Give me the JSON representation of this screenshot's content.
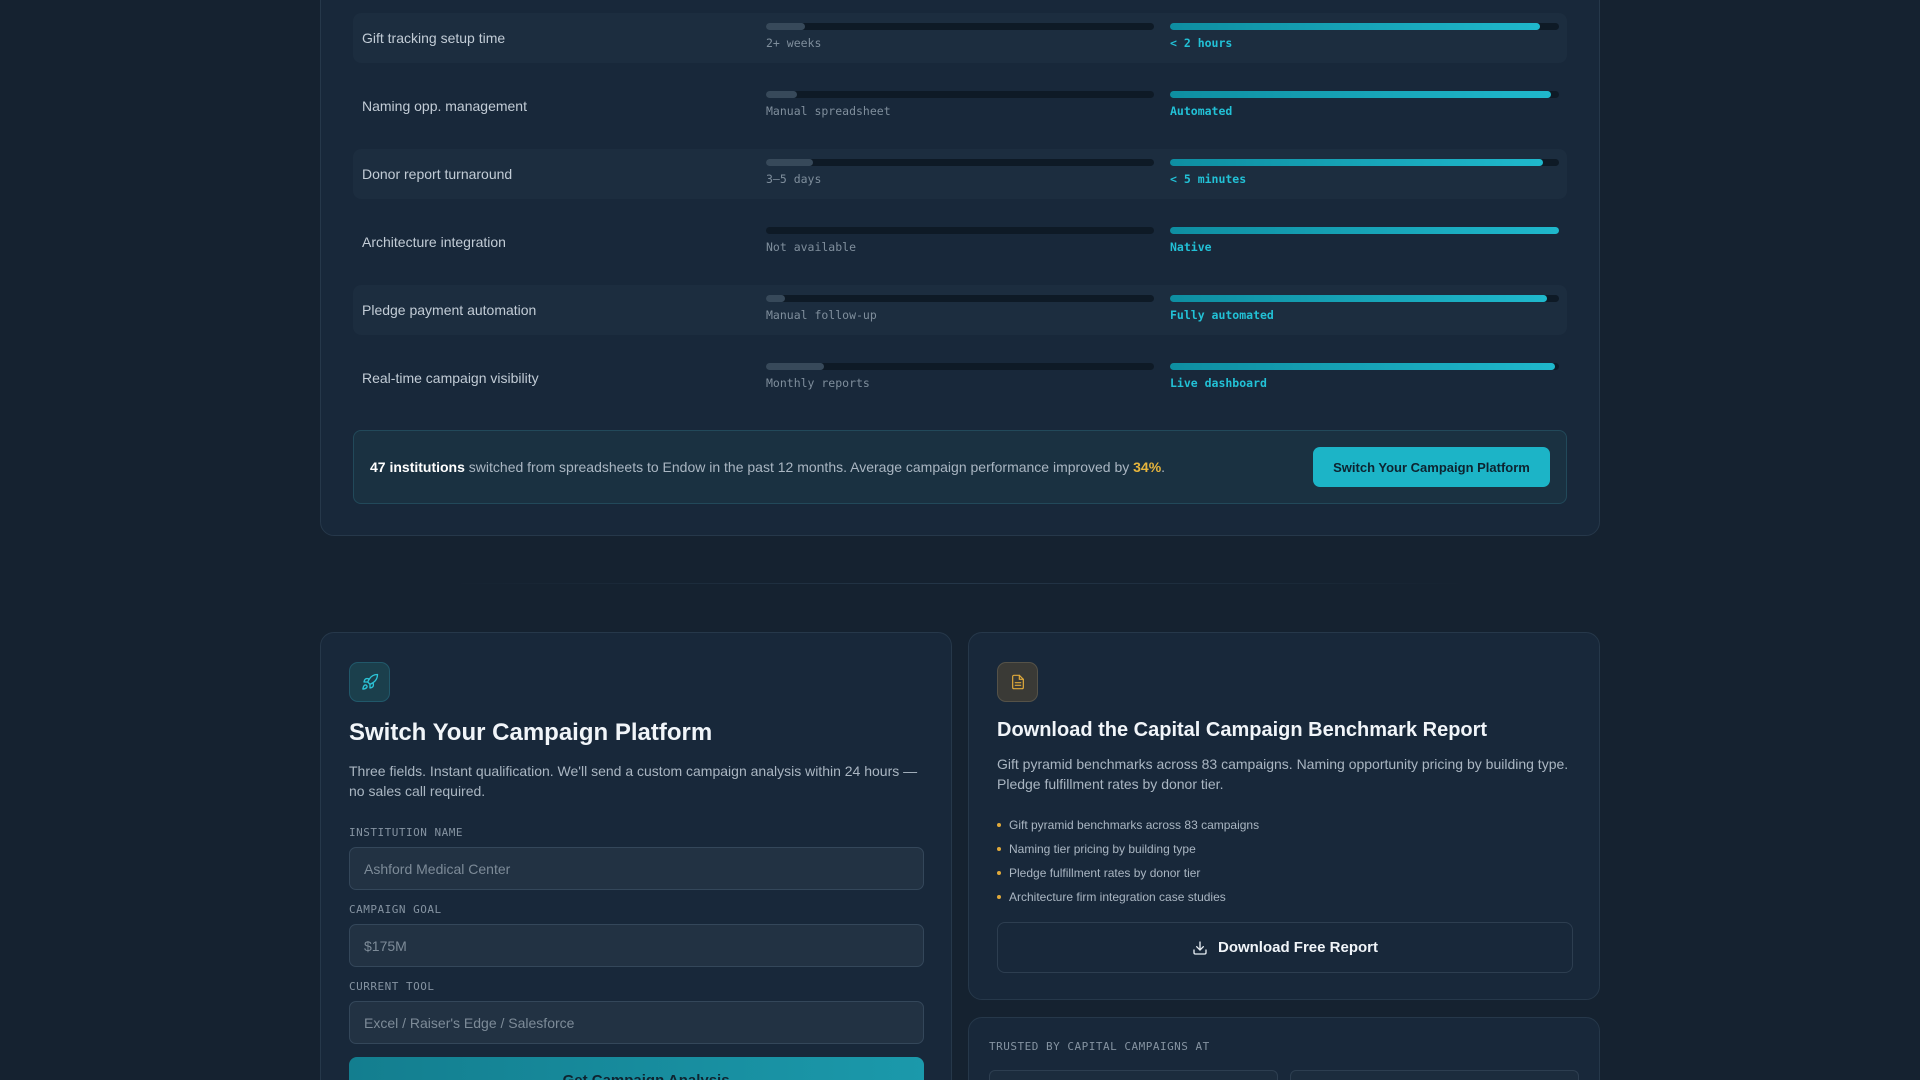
{
  "comparison": {
    "rows": [
      {
        "label": "Gift tracking setup time",
        "old_caption": "2+ weeks",
        "old_level": 0.1,
        "new_caption": "< 2 hours",
        "new_level": 0.95
      },
      {
        "label": "Naming opp. management",
        "old_caption": "Manual spreadsheet",
        "old_level": 0.08,
        "new_caption": "Automated",
        "new_level": 0.98
      },
      {
        "label": "Donor report turnaround",
        "old_caption": "3–5 days",
        "old_level": 0.12,
        "new_caption": "< 5 minutes",
        "new_level": 0.96
      },
      {
        "label": "Architecture integration",
        "old_caption": "Not available",
        "old_level": 0.0,
        "new_caption": "Native",
        "new_level": 1.0
      },
      {
        "label": "Pledge payment automation",
        "old_caption": "Manual follow-up",
        "old_level": 0.05,
        "new_caption": "Fully automated",
        "new_level": 0.97
      },
      {
        "label": "Real-time campaign visibility",
        "old_caption": "Monthly reports",
        "old_level": 0.15,
        "new_caption": "Live dashboard",
        "new_level": 0.99
      }
    ],
    "banner": {
      "count": "47 institutions",
      "text_mid": " switched from spreadsheets to Endow in the past 12 months. Average campaign performance improved by ",
      "percent": "34%",
      "text_end": ".",
      "button_label": "Switch Your Campaign Platform"
    }
  },
  "form_card": {
    "icon": "rocket-icon",
    "title": "Switch Your Campaign Platform",
    "description": "Three fields. Instant qualification. We'll send a custom campaign analysis within 24 hours — no sales call required.",
    "fields": [
      {
        "label": "INSTITUTION NAME",
        "placeholder": "Ashford Medical Center"
      },
      {
        "label": "CAMPAIGN GOAL",
        "placeholder": "$175M"
      },
      {
        "label": "CURRENT TOOL",
        "placeholder": "Excel / Raiser's Edge / Salesforce"
      }
    ],
    "submit_label": "→ Get Campaign Analysis"
  },
  "report_card": {
    "icon": "document-icon",
    "title": "Download the Capital Campaign Benchmark Report",
    "description": "Gift pyramid benchmarks across 83 campaigns. Naming opportunity pricing by building type. Pledge fulfillment rates by donor tier.",
    "bullets": [
      "Gift pyramid benchmarks across 83 campaigns",
      "Naming tier pricing by building type",
      "Pledge fulfillment rates by donor tier",
      "Architecture firm integration case studies"
    ],
    "download_label": "Download Free Report"
  },
  "trusted": {
    "label": "TRUSTED BY CAPITAL CAMPAIGNS AT"
  }
}
